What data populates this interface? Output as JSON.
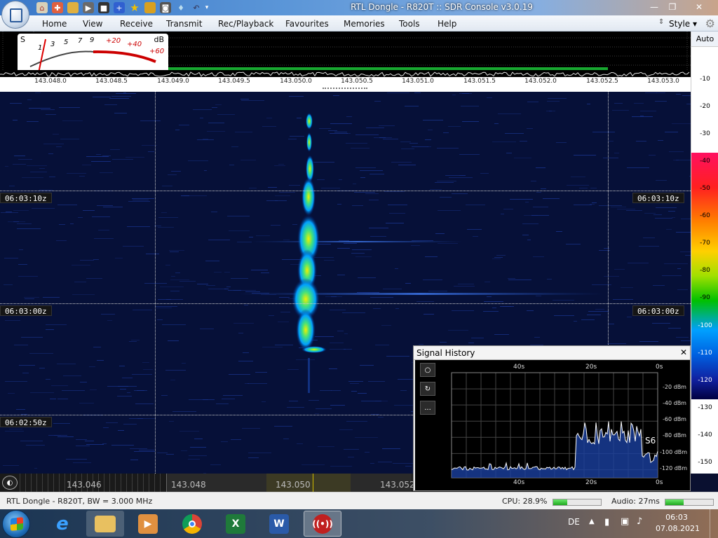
{
  "titlebar": {
    "title": "RTL Dongle - R820T :: SDR Console v3.0.19"
  },
  "menu": {
    "items": [
      "Home",
      "View",
      "Receive",
      "Transmit",
      "Rec/Playback",
      "Favourites",
      "Memories",
      "Tools",
      "Help"
    ],
    "style_label": "Style"
  },
  "smeter": {
    "label_s": "S",
    "label_db": "dB",
    "scale": [
      "1",
      "3",
      "5",
      "7",
      "9",
      "+20",
      "+40",
      "+60"
    ]
  },
  "spectrum": {
    "freq_labels": [
      "143.048.0",
      "143.048.5",
      "143.049.0",
      "143.049.5",
      "143.050.0",
      "143.050.5",
      "143.051.0",
      "143.051.5",
      "143.052.0",
      "143.052.5",
      "143.053.0"
    ]
  },
  "scale": {
    "auto_label": "Auto",
    "levels": [
      "-10",
      "-20",
      "-30",
      "-40",
      "-50",
      "-60",
      "-70",
      "-80",
      "-90",
      "-100",
      "-110",
      "-120",
      "-130",
      "-140",
      "-150"
    ]
  },
  "waterfall": {
    "time_labels": [
      "06:03:10z",
      "06:03:00z",
      "06:02:50z"
    ]
  },
  "bottom_freq": {
    "labels": [
      "143.046",
      "143.048",
      "143.050",
      "143.052"
    ]
  },
  "signal_history": {
    "title": "Signal History",
    "time_labels": [
      "40s",
      "20s",
      "0s"
    ],
    "dbm_labels": [
      "-20 dBm",
      "-40 dBm",
      "-60 dBm",
      "-80 dBm",
      "-100 dBm",
      "-120 dBm"
    ],
    "s_reading": "S6",
    "button_icons": [
      "record-icon",
      "refresh-icon",
      "more-icon"
    ],
    "more_label": "..."
  },
  "statusbar": {
    "device": "RTL Dongle - R820T, BW = 3.000 MHz",
    "cpu": "CPU: 28.9%",
    "cpu_value": 28.9,
    "audio": "Audio: 27ms"
  },
  "taskbar": {
    "lang": "DE",
    "time": "06:03",
    "date": "07.08.2021"
  },
  "colors": {
    "accent": "#3a78c8",
    "waterfall_bg": "#061038",
    "spectrum_green": "#18a830",
    "trace": "#ffffff"
  }
}
